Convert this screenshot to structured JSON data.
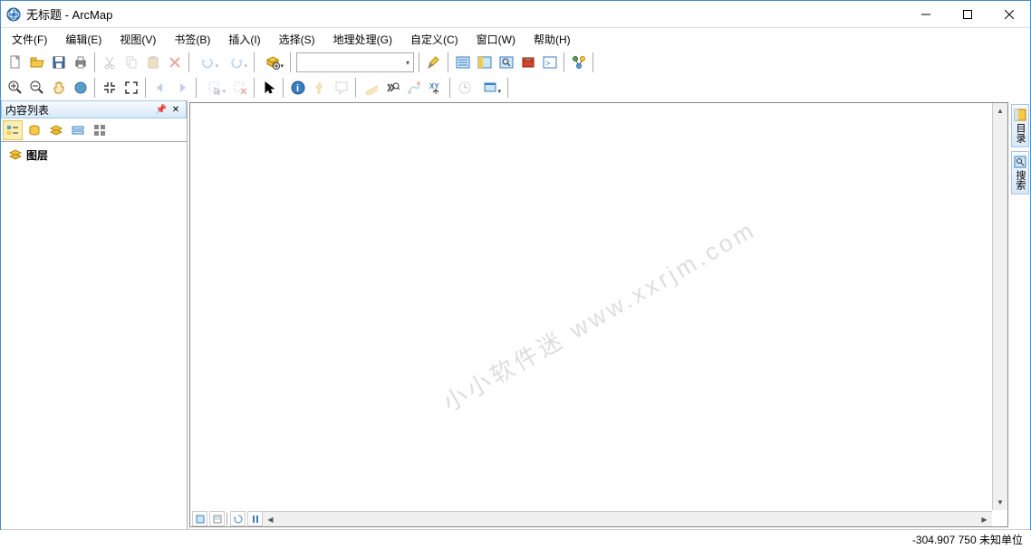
{
  "titlebar": {
    "title": "无标题 - ArcMap"
  },
  "menubar": {
    "items": [
      "文件(F)",
      "编辑(E)",
      "视图(V)",
      "书签(B)",
      "插入(I)",
      "选择(S)",
      "地理处理(G)",
      "自定义(C)",
      "窗口(W)",
      "帮助(H)"
    ]
  },
  "toolbar1": {
    "scale_value": "",
    "buttons": {
      "new": "new-doc",
      "open": "open",
      "save": "save",
      "print": "print",
      "cut": "cut",
      "copy": "copy",
      "paste": "paste",
      "delete": "delete",
      "undo": "undo",
      "redo": "redo",
      "add_data": "add-data",
      "editor": "editor-toolbar",
      "toc": "table-of-contents",
      "catalog": "catalog-window",
      "search": "search-window",
      "toolbox": "arctoolbox",
      "python": "python-window",
      "model": "model-builder"
    }
  },
  "toolbar2": {
    "buttons": {
      "zoom_in": "zoom-in",
      "zoom_out": "zoom-out",
      "pan": "pan",
      "full": "full-extent",
      "fixed_in": "fixed-zoom-in",
      "fixed_out": "fixed-zoom-out",
      "back": "back-extent",
      "forward": "forward-extent",
      "select_features": "select-features",
      "clear_sel": "clear-selection",
      "pointer": "select-elements",
      "identify": "identify",
      "hyperlink": "hyperlink",
      "html_popup": "html-popup",
      "measure": "measure",
      "find": "find",
      "find_route": "find-route",
      "goto_xy": "go-to-xy",
      "time": "time-slider",
      "viewer": "create-viewer"
    }
  },
  "toc": {
    "title": "内容列表",
    "root_label": "图层",
    "tabs": [
      "list-by-drawing-order",
      "list-by-source",
      "list-by-visibility",
      "list-by-selection",
      "options"
    ]
  },
  "sidepanels": {
    "catalog": "目录",
    "search": "搜索"
  },
  "canvas": {
    "watermark": "小小软件迷 www.xxrjm.com"
  },
  "status": {
    "coords": "-304.907  750 未知单位"
  },
  "view_tabs": [
    "data-view",
    "layout-view",
    "refresh",
    "pause"
  ]
}
